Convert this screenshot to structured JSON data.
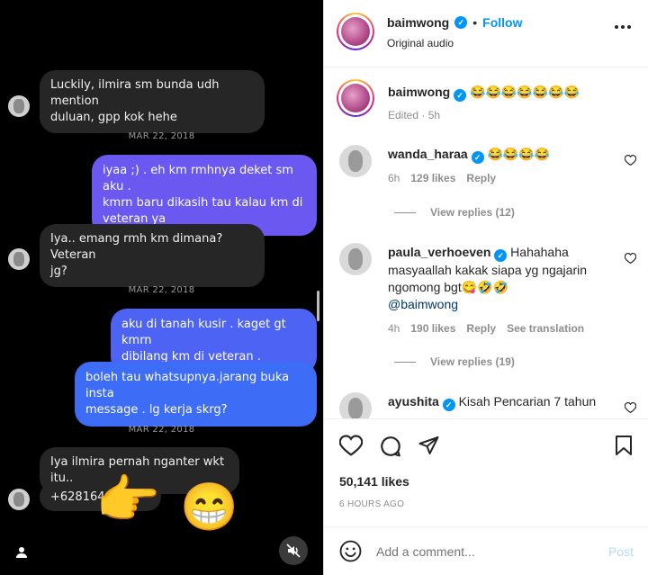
{
  "chat": {
    "messages": [
      {
        "side": "in",
        "text_lines": [
          "Luckily, ilmira sm bunda udh mention",
          "duluan, gpp kok hehe"
        ]
      },
      {
        "side": "date",
        "text": "MAR 22, 2018"
      },
      {
        "side": "out",
        "text_lines": [
          "iyaa ;) . eh km rmhnya deket sm aku .",
          "kmrn baru dikasih tau kalau km di",
          "veteran ya"
        ]
      },
      {
        "side": "in",
        "text_lines": [
          "Iya.. emang rmh km dimana? Veteran",
          "jg?"
        ]
      },
      {
        "side": "date",
        "text": "MAR 22, 2018"
      },
      {
        "side": "out",
        "text_lines": [
          "aku di tanah kusir . kaget gt kmrn",
          "dibilang km di veteran ."
        ]
      },
      {
        "side": "out",
        "text_lines": [
          "boleh tau whatsupnya.jarang buka insta",
          "message . lg kerja skrg?"
        ]
      },
      {
        "side": "date",
        "text": "MAR 22, 2018"
      },
      {
        "side": "in",
        "text_lines": [
          "Iya ilmira pernah nganter wkt itu.."
        ]
      },
      {
        "side": "in",
        "text_lines": [
          "+628164"
        ]
      }
    ],
    "overlay_emojis": [
      "👉",
      "😁"
    ]
  },
  "header": {
    "username": "baimwong",
    "follow_label": "Follow",
    "audio_label": "Original audio",
    "more_icon": "more-horizontal-icon"
  },
  "caption": {
    "username": "baimwong",
    "text": "😂😂😂😂😂😂😂",
    "meta": "Edited · 5h"
  },
  "comments": [
    {
      "username": "wanda_haraa",
      "text": "😂😂😂😂",
      "time": "6h",
      "likes": "129 likes",
      "reply": "Reply",
      "view_replies": "View replies (12)"
    },
    {
      "username": "paula_verhoeven",
      "text": "Hahahaha masyaallah kakak siapa yg ngajarin ngomong bgt😋🤣🤣",
      "mention": "@baimwong",
      "time": "4h",
      "likes": "190 likes",
      "reply": "Reply",
      "translate": "See translation",
      "view_replies": "View replies (19)"
    },
    {
      "username": "ayushita",
      "text": "Kisah Pencarian 7 tahun"
    }
  ],
  "actions": {
    "likes": "50,141 likes",
    "time_ago": "6 HOURS AGO"
  },
  "add_comment": {
    "placeholder": "Add a comment...",
    "post_label": "Post"
  },
  "colors": {
    "accent": "#0095f6",
    "bubble_out_1": "#6a58f0",
    "bubble_out_2": "#4d63f4",
    "bubble_in": "#262626"
  }
}
